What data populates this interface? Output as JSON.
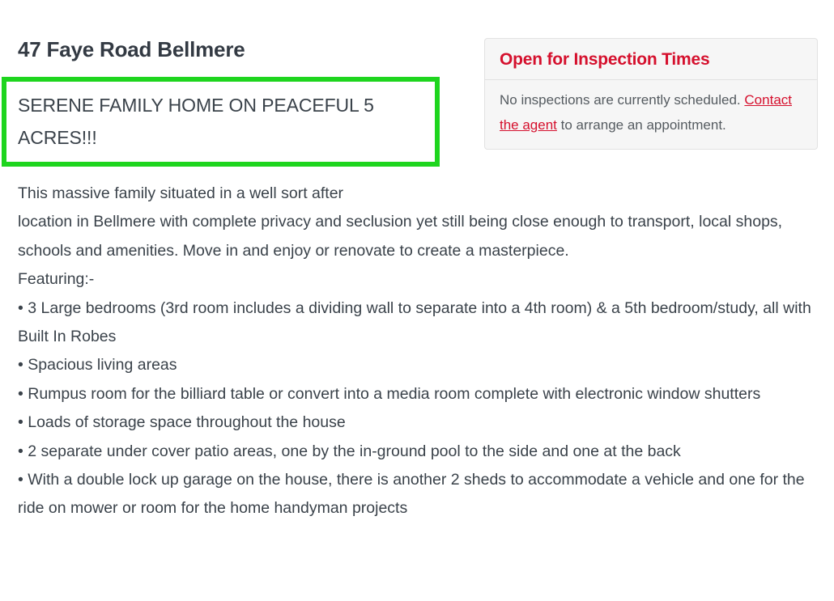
{
  "listing": {
    "address_title": "47 Faye Road Bellmere",
    "highlight_subheading": "SERENE FAMILY HOME ON PEACEFUL 5 ACRES!!!",
    "highlight_border_color": "#1ed51e"
  },
  "inspection_card": {
    "title": "Open for Inspection Times",
    "status_text": "No inspections are currently scheduled.",
    "link_label": "Contact the agent",
    "link_suffix": " to arrange an appointment.",
    "accent_color": "#d5102d"
  },
  "description": {
    "intro_lines": [
      "This massive family situated in a well sort after",
      "location in Bellmere with complete privacy and seclusion yet still being close enough to transport, local shops, schools and amenities. Move in and enjoy or renovate to create a masterpiece."
    ],
    "featuring_label": "Featuring:-",
    "features": [
      "• 3 Large bedrooms (3rd room includes a dividing wall to separate into a 4th room) & a 5th bedroom/study, all with Built In Robes",
      "• Spacious living areas",
      "• Rumpus room for the billiard table or convert into a media room complete with electronic window shutters",
      "• Loads of storage space throughout the house",
      "• 2 separate under cover patio areas, one by the in-ground pool to the side and one at the back",
      "• With a double lock up garage on the house, there is another 2 sheds to accommodate a vehicle and one for the ride on mower or room for the home handyman projects"
    ]
  }
}
